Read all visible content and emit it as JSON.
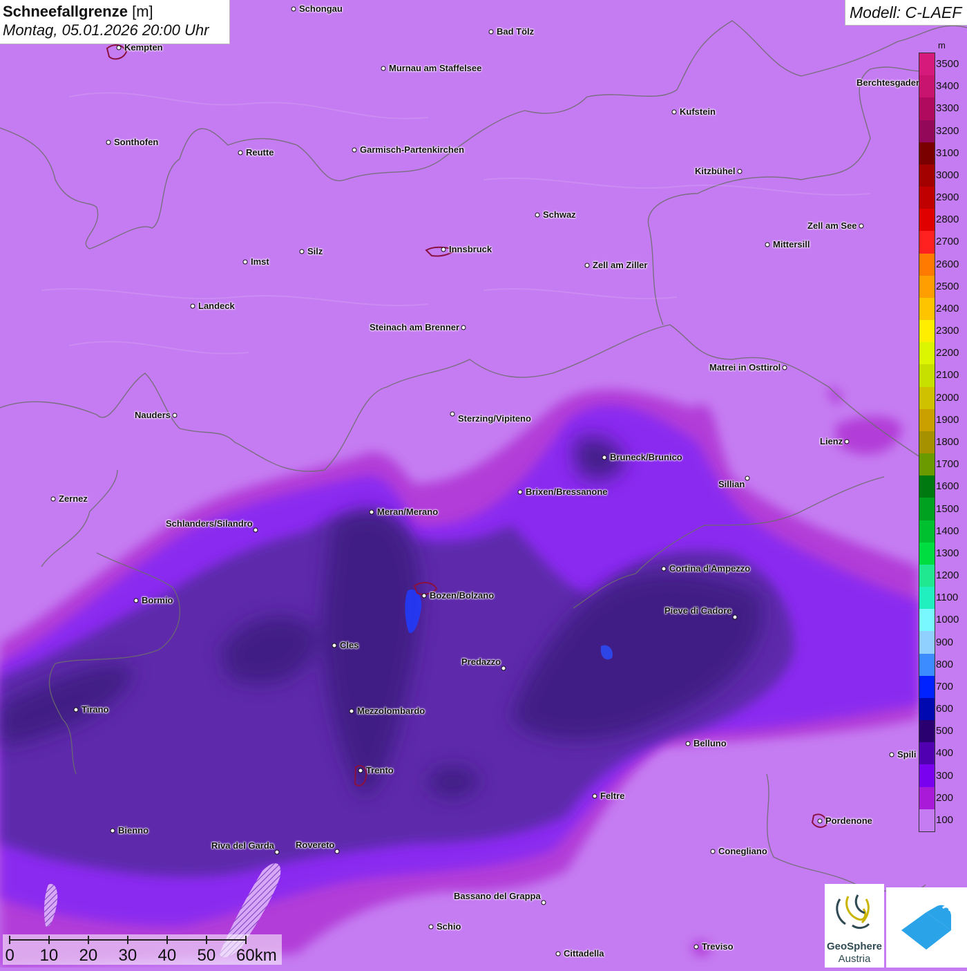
{
  "title": {
    "parameter": "Schneefallgrenze",
    "unit": "[m]",
    "datetime": "Montag, 05.01.2026 20:00 Uhr"
  },
  "model_label": "Modell: C-LAEF",
  "legend": {
    "unit": "m",
    "levels": [
      {
        "label": "3500",
        "color": "#d61a7c"
      },
      {
        "label": "3400",
        "color": "#c8146f"
      },
      {
        "label": "3300",
        "color": "#b00a5e"
      },
      {
        "label": "3200",
        "color": "#94085a"
      },
      {
        "label": "3100",
        "color": "#7a0000"
      },
      {
        "label": "3000",
        "color": "#a30000"
      },
      {
        "label": "2900",
        "color": "#c00000"
      },
      {
        "label": "2800",
        "color": "#e00000"
      },
      {
        "label": "2700",
        "color": "#ff2020"
      },
      {
        "label": "2600",
        "color": "#ff7a00"
      },
      {
        "label": "2500",
        "color": "#ff9e00"
      },
      {
        "label": "2400",
        "color": "#ffc400"
      },
      {
        "label": "2300",
        "color": "#ffee00"
      },
      {
        "label": "2200",
        "color": "#dcf500"
      },
      {
        "label": "2100",
        "color": "#c8e000"
      },
      {
        "label": "2000",
        "color": "#cfc000"
      },
      {
        "label": "1900",
        "color": "#c9a000"
      },
      {
        "label": "1800",
        "color": "#a69200"
      },
      {
        "label": "1700",
        "color": "#6a9a00"
      },
      {
        "label": "1600",
        "color": "#007a10"
      },
      {
        "label": "1500",
        "color": "#00a020"
      },
      {
        "label": "1400",
        "color": "#00c030"
      },
      {
        "label": "1300",
        "color": "#00dd40"
      },
      {
        "label": "1200",
        "color": "#20e890"
      },
      {
        "label": "1100",
        "color": "#20f0c0"
      },
      {
        "label": "1000",
        "color": "#7af8ff"
      },
      {
        "label": "900",
        "color": "#90d0ff"
      },
      {
        "label": "800",
        "color": "#3c8cff"
      },
      {
        "label": "700",
        "color": "#0022ff"
      },
      {
        "label": "600",
        "color": "#0008b0"
      },
      {
        "label": "500",
        "color": "#2a0070"
      },
      {
        "label": "400",
        "color": "#5000b0"
      },
      {
        "label": "300",
        "color": "#7a00f0"
      },
      {
        "label": "200",
        "color": "#a81ad8"
      },
      {
        "label": "100",
        "color": "#c57cf2"
      }
    ]
  },
  "cities": [
    {
      "name": "Schongau"
    },
    {
      "name": "Bad Tölz"
    },
    {
      "name": "Kempten"
    },
    {
      "name": "Murnau am Staffelsee"
    },
    {
      "name": "Berchtesgaden"
    },
    {
      "name": "Kufstein"
    },
    {
      "name": "Sonthofen"
    },
    {
      "name": "Reutte"
    },
    {
      "name": "Garmisch-Partenkirchen"
    },
    {
      "name": "Kitzbühel"
    },
    {
      "name": "Schwaz"
    },
    {
      "name": "Zell am See"
    },
    {
      "name": "Innsbruck"
    },
    {
      "name": "Mittersill"
    },
    {
      "name": "Imst"
    },
    {
      "name": "Silz"
    },
    {
      "name": "Zell am Ziller"
    },
    {
      "name": "Landeck"
    },
    {
      "name": "Steinach am Brenner"
    },
    {
      "name": "Matrei in Osttirol"
    },
    {
      "name": "Nauders"
    },
    {
      "name": "Sterzing/Vipiteno"
    },
    {
      "name": "Lienz"
    },
    {
      "name": "Bruneck/Brunico"
    },
    {
      "name": "Sillian"
    },
    {
      "name": "Brixen/Bressanone"
    },
    {
      "name": "Zernez"
    },
    {
      "name": "Meran/Merano"
    },
    {
      "name": "Schlanders/Silandro"
    },
    {
      "name": "Cortina d'Ampezzo"
    },
    {
      "name": "Bormio"
    },
    {
      "name": "Bozen/Bolzano"
    },
    {
      "name": "Pieve di Cadore"
    },
    {
      "name": "Cles"
    },
    {
      "name": "Predazzo"
    },
    {
      "name": "Tirano"
    },
    {
      "name": "Mezzolombardo"
    },
    {
      "name": "Belluno"
    },
    {
      "name": "Spili"
    },
    {
      "name": "Trento"
    },
    {
      "name": "Feltre"
    },
    {
      "name": "Pordenone"
    },
    {
      "name": "Bienno"
    },
    {
      "name": "Riva del Garda"
    },
    {
      "name": "Rovereto"
    },
    {
      "name": "Conegliano"
    },
    {
      "name": "Bassano del Grappa"
    },
    {
      "name": "Schio"
    },
    {
      "name": "Treviso"
    },
    {
      "name": "Cittadella"
    }
  ],
  "scale_bar": {
    "ticks": [
      "0",
      "10",
      "20",
      "30",
      "40",
      "50",
      "60km"
    ]
  },
  "logo": {
    "name_line1": "GeoSphere",
    "name_line2": "Austria"
  },
  "icons": [
    "geosphere-logo-icon",
    "app-logo-icon"
  ]
}
